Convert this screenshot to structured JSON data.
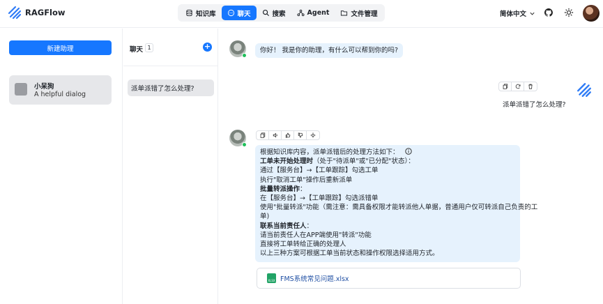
{
  "app": {
    "brand": "RAGFlow"
  },
  "nav": {
    "tabs": [
      {
        "label": "知识库",
        "icon": "database-icon"
      },
      {
        "label": "聊天",
        "icon": "chat-icon",
        "active": true
      },
      {
        "label": "搜索",
        "icon": "search-icon"
      },
      {
        "label": "Agent",
        "icon": "agent-icon"
      },
      {
        "label": "文件管理",
        "icon": "folder-icon"
      }
    ]
  },
  "header": {
    "language": "简体中文"
  },
  "sidebar": {
    "new_assistant_label": "新建助理",
    "assistants": [
      {
        "name": "小呆狗",
        "description": "A helpful dialog"
      }
    ]
  },
  "conversations": {
    "title": "聊天",
    "count": "1",
    "items": [
      {
        "label": "派单派错了怎么处理?"
      }
    ]
  },
  "chat": {
    "greeting": "你好！ 我是你的助理，有什么可以帮到你的吗?",
    "user_question": "派单派错了怎么处理?",
    "answer": {
      "intro": "根据知识库内容，派单派错后的处理方法如下：",
      "s1_title": "工单未开始处理时",
      "s1_suffix": "（处于\"待派单\"或\"已分配\"状态）：",
      "s1_l1": "通过【服务台】→【工单跟踪】勾选工单",
      "s1_l2": "执行\"取消工单\"操作后重新派单",
      "s2_title": "批量转派操作",
      "s2_suffix": "：",
      "s2_l1": "在【服务台】→【工单跟踪】勾选派错单",
      "s2_l2a": "使用\"批量转派\"功能（需注意：需具备权限才能转派他人单据，普通用户仅可转派自己负责的工",
      "s2_l2b": "单)",
      "s3_title": "联系当前责任人",
      "s3_suffix": "：",
      "s3_l1": "请当前责任人在APP端使用\"转派\"功能",
      "s3_l2": "直接将工单转给正确的处理人",
      "closing": "以上三种方案可根据工单当前状态和操作权限选择适用方式。"
    },
    "reference_file": "FMS系统常见问题.xlsx",
    "reference_file_badge": "XLSX"
  },
  "colors": {
    "accent": "#1677ff",
    "bubble": "#e6f2fd",
    "online": "#1fbf5a"
  }
}
